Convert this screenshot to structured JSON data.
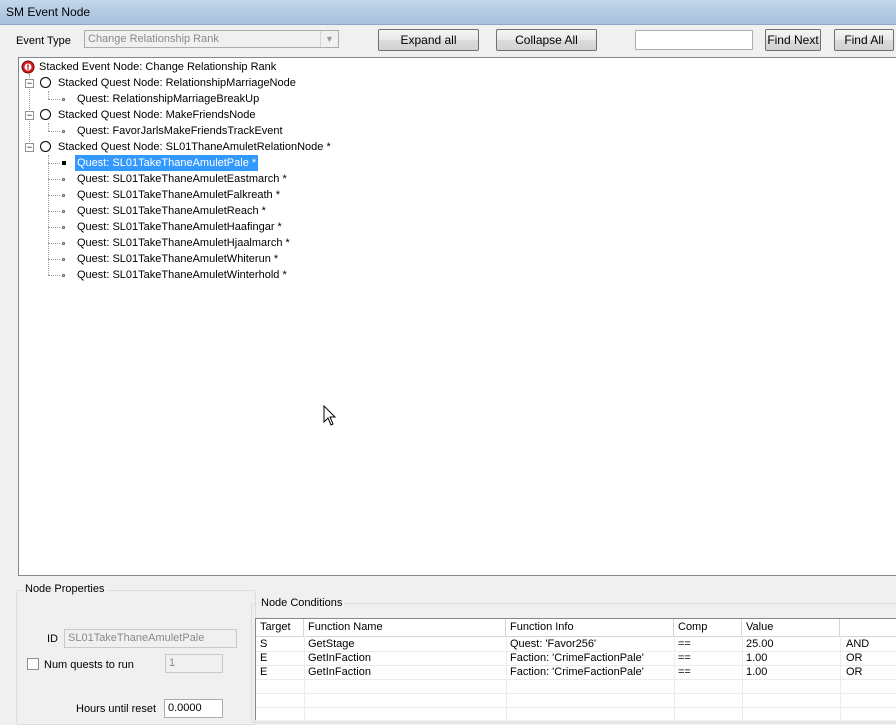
{
  "window": {
    "title": "SM Event Node"
  },
  "toolbar": {
    "event_type_label": "Event Type",
    "event_type_value": "Change Relationship Rank",
    "expand_all": "Expand all",
    "collapse_all": "Collapse All",
    "search_value": "",
    "find_next": "Find Next",
    "find_all": "Find All"
  },
  "tree": {
    "root": "Stacked Event Node: Change Relationship Rank",
    "nodes": [
      {
        "label": "Stacked Quest Node: RelationshipMarriageNode",
        "children": [
          "Quest: RelationshipMarriageBreakUp"
        ]
      },
      {
        "label": "Stacked Quest Node: MakeFriendsNode",
        "children": [
          "Quest: FavorJarlsMakeFriendsTrackEvent"
        ]
      },
      {
        "label": "Stacked Quest Node: SL01ThaneAmuletRelationNode *",
        "children": [
          "Quest: SL01TakeThaneAmuletPale *",
          "Quest: SL01TakeThaneAmuletEastmarch *",
          "Quest: SL01TakeThaneAmuletFalkreath *",
          "Quest: SL01TakeThaneAmuletReach *",
          "Quest: SL01TakeThaneAmuletHaafingar *",
          "Quest: SL01TakeThaneAmuletHjaalmarch *",
          "Quest: SL01TakeThaneAmuletWhiterun *",
          "Quest: SL01TakeThaneAmuletWinterhold *"
        ]
      }
    ],
    "selected": "Quest: SL01TakeThaneAmuletPale *"
  },
  "node_properties": {
    "title": "Node Properties",
    "id_label": "ID",
    "id_value": "SL01TakeThaneAmuletPale",
    "num_quests_label": "Num quests to run",
    "num_quests_checked": false,
    "num_quests_value": "1",
    "hours_label": "Hours until reset",
    "hours_value": "0.0000"
  },
  "node_conditions": {
    "title": "Node Conditions",
    "columns": [
      "Target",
      "Function Name",
      "Function Info",
      "Comp",
      "Value",
      ""
    ],
    "rows": [
      [
        "S",
        "GetStage",
        "Quest: 'Favor256'",
        "==",
        "25.00",
        "AND"
      ],
      [
        "E",
        "GetInFaction",
        "Faction: 'CrimeFactionPale'",
        "==",
        "1.00",
        "OR"
      ],
      [
        "E",
        "GetInFaction",
        "Faction: 'CrimeFactionPale'",
        "==",
        "1.00",
        "OR"
      ]
    ]
  }
}
